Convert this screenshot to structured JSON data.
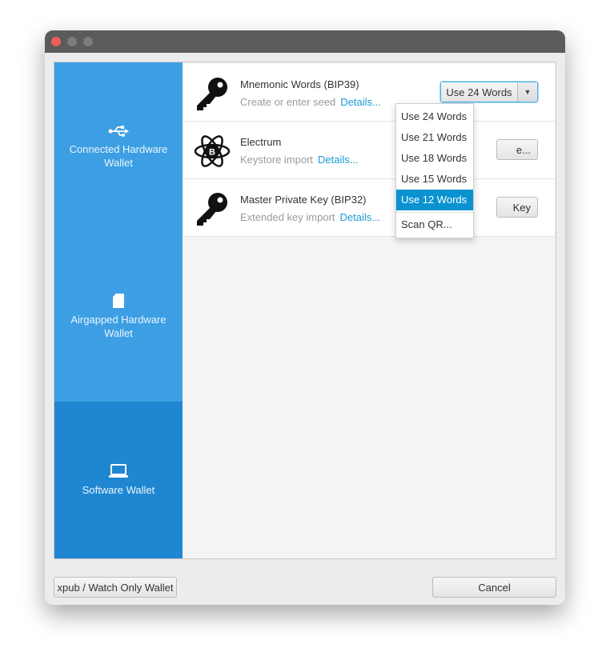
{
  "sidebar": {
    "items": [
      {
        "label": "Connected Hardware Wallet",
        "icon": "usb-icon"
      },
      {
        "label": "Airgapped Hardware Wallet",
        "icon": "sd-card-icon"
      },
      {
        "label": "Software Wallet",
        "icon": "laptop-icon",
        "selected": true
      }
    ]
  },
  "rows": [
    {
      "title": "Mnemonic Words (BIP39)",
      "subtitle": "Create or enter seed",
      "details": "Details...",
      "icon": "key-icon",
      "button": "Use 24 Words"
    },
    {
      "title": "Electrum",
      "subtitle": "Keystore import",
      "details": "Details...",
      "icon": "electrum-icon",
      "button": "e..."
    },
    {
      "title": "Master Private Key (BIP32)",
      "subtitle": "Extended key import",
      "details": "Details...",
      "icon": "key-icon",
      "button": "Key"
    }
  ],
  "dropdown": {
    "options": [
      "Use 24 Words",
      "Use 21 Words",
      "Use 18 Words",
      "Use 15 Words",
      "Use 12 Words",
      "Scan QR..."
    ],
    "highlighted": "Use 12 Words"
  },
  "footer": {
    "watch_only": "xpub / Watch Only Wallet",
    "cancel": "Cancel"
  },
  "colors": {
    "sidebar": "#3d9fe3",
    "sidebar_selected": "#1f87d1",
    "link": "#1a9ad6",
    "highlight": "#0b93d1"
  }
}
